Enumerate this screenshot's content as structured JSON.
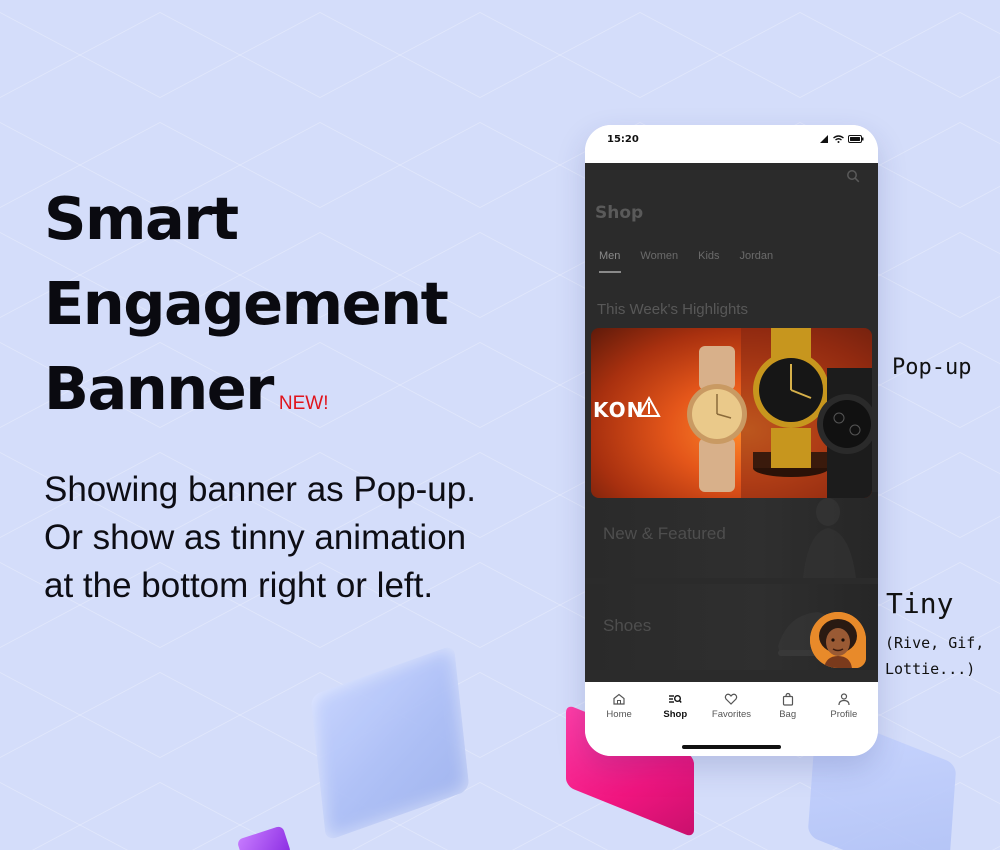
{
  "hero": {
    "title_lines": [
      "Smart",
      "Engagement",
      "Banner"
    ],
    "badge": "NEW!",
    "subtitle_lines": [
      "Showing banner as Pop-up.",
      "Or show as tinny animation",
      "at the bottom right or left."
    ]
  },
  "phone": {
    "status": {
      "time": "15:20"
    },
    "page_title": "Shop",
    "tabs": [
      {
        "label": "Men",
        "active": true
      },
      {
        "label": "Women",
        "active": false
      },
      {
        "label": "Kids",
        "active": false
      },
      {
        "label": "Jordan",
        "active": false
      }
    ],
    "section_title": "This Week's Highlights",
    "banner": {
      "logo_text": "KON"
    },
    "cards": [
      {
        "label": "New & Featured"
      },
      {
        "label": "Shoes"
      }
    ],
    "bottom_nav": [
      {
        "label": "Home",
        "icon": "home-icon",
        "active": false
      },
      {
        "label": "Shop",
        "icon": "shop-search-icon",
        "active": true
      },
      {
        "label": "Favorites",
        "icon": "heart-icon",
        "active": false
      },
      {
        "label": "Bag",
        "icon": "bag-icon",
        "active": false
      },
      {
        "label": "Profile",
        "icon": "person-icon",
        "active": false
      }
    ]
  },
  "annotations": {
    "popup": "Pop-up",
    "tiny": "Tiny",
    "tiny_sub_lines": [
      "(Rive, Gif,",
      "Lottie...)"
    ]
  },
  "colors": {
    "background": "#d4ddfa",
    "badge": "#e0141c",
    "screen_dark": "#2b2b2b"
  }
}
